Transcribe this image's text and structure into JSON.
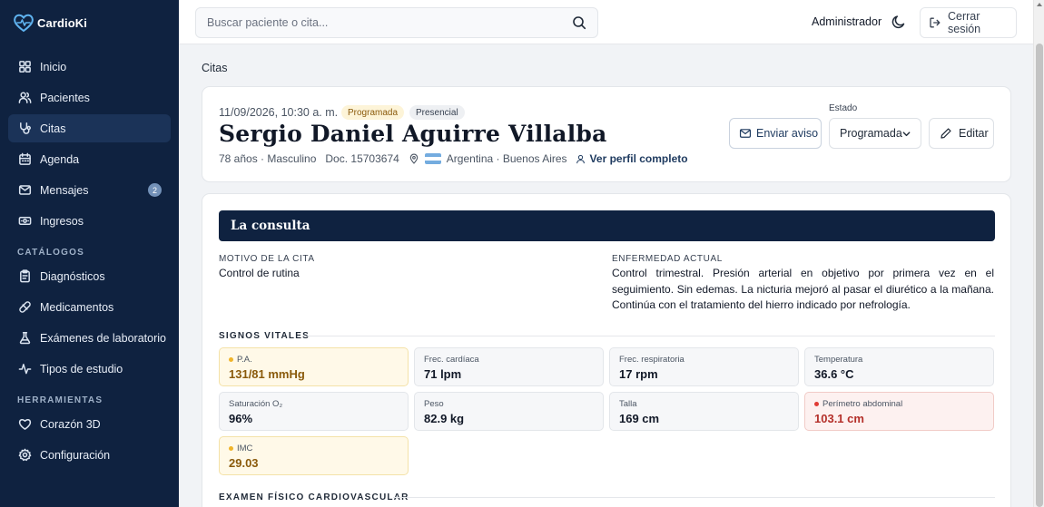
{
  "app": {
    "name": "CardioKi"
  },
  "sidebar": {
    "items": [
      {
        "label": "Inicio",
        "icon": "grid-icon"
      },
      {
        "label": "Pacientes",
        "icon": "users-icon"
      },
      {
        "label": "Citas",
        "icon": "stethoscope-icon",
        "active": true
      },
      {
        "label": "Agenda",
        "icon": "calendar-icon"
      },
      {
        "label": "Mensajes",
        "icon": "mail-icon",
        "badge": "2"
      },
      {
        "label": "Ingresos",
        "icon": "banknote-icon"
      }
    ],
    "catalogs_title": "CATÁLOGOS",
    "catalogs": [
      {
        "label": "Diagnósticos",
        "icon": "clipboard-icon"
      },
      {
        "label": "Medicamentos",
        "icon": "pill-icon"
      },
      {
        "label": "Exámenes de laboratorio",
        "icon": "flask-icon"
      },
      {
        "label": "Tipos de estudio",
        "icon": "activity-icon"
      }
    ],
    "tools_title": "HERRAMIENTAS",
    "tools": [
      {
        "label": "Corazón 3D",
        "icon": "heart-icon"
      },
      {
        "label": "Configuración",
        "icon": "gear-icon"
      }
    ]
  },
  "header": {
    "search_placeholder": "Buscar paciente o cita...",
    "user": "Administrador",
    "logout_label": "Cerrar sesión"
  },
  "breadcrumb": "Citas",
  "appointment": {
    "datetime": "11/09/2026, 10:30 a. m.",
    "status_badge": "Programada",
    "modality_badge": "Presencial",
    "patient_name": "Sergio Daniel Aguirre Villalba",
    "age_sex": "78 años · Masculino",
    "document": "Doc. 15703674",
    "location": "Argentina · Buenos Aires",
    "profile_link": "Ver perfil completo",
    "estado_label": "Estado",
    "estado_value": "Programada",
    "notify_label": "Enviar aviso",
    "edit_label": "Editar"
  },
  "consulta": {
    "title": "La consulta",
    "motivo_label": "MOTIVO DE LA CITA",
    "motivo": "Control de rutina",
    "enfermedad_label": "ENFERMEDAD ACTUAL",
    "enfermedad": "Control trimestral. Presión arterial en objetivo por primera vez en el seguimiento. Sin edemas. La nicturia mejoró al pasar el diurético a la mañana. Continúa con el tratamiento del hierro indicado por nefrología.",
    "vitals_title": "SIGNOS VITALES",
    "vitals": [
      {
        "label": "P.A.",
        "value": "131/81 mmHg",
        "status": "warn"
      },
      {
        "label": "Frec. cardíaca",
        "value": "71 lpm",
        "status": "normal"
      },
      {
        "label": "Frec. respiratoria",
        "value": "17 rpm",
        "status": "normal"
      },
      {
        "label": "Temperatura",
        "value": "36.6 °C",
        "status": "normal"
      },
      {
        "label": "Saturación O₂",
        "value": "96%",
        "status": "normal"
      },
      {
        "label": "Peso",
        "value": "82.9 kg",
        "status": "normal"
      },
      {
        "label": "Talla",
        "value": "169 cm",
        "status": "normal"
      },
      {
        "label": "Perímetro abdominal",
        "value": "103.1 cm",
        "status": "alert"
      },
      {
        "label": "IMC",
        "value": "29.03",
        "status": "warn"
      }
    ],
    "exam_title": "EXAMEN FÍSICO CARDIOVASCULAR"
  },
  "colors": {
    "sidebar_bg": "#0f2240",
    "warn": "#f0b429",
    "alert": "#e03b35",
    "accent": "#1e3a5f"
  }
}
